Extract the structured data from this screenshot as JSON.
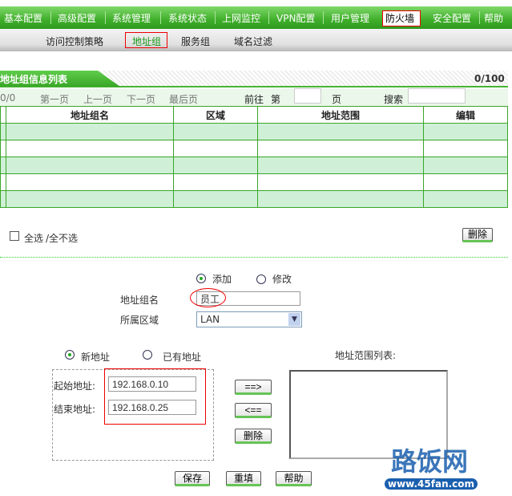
{
  "nav": {
    "items": [
      "基本配置",
      "高级配置",
      "系统管理",
      "系统状态",
      "上网监控",
      "VPN配置",
      "用户管理",
      "防火墙",
      "安全配置",
      "帮助"
    ],
    "active": "防火墙"
  },
  "subnav": {
    "items": [
      "访问控制策略",
      "地址组",
      "服务组",
      "域名过滤"
    ],
    "active": "地址组"
  },
  "list": {
    "title": "地址组信息列表",
    "count": "0/100",
    "pager": {
      "pages": "0/0",
      "first": "第一页",
      "prev": "上一页",
      "next": "下一页",
      "last": "最后页",
      "goto": "前往",
      "di": "第",
      "ye": "页",
      "search": "搜索",
      "page_value": "",
      "search_value": ""
    },
    "columns": [
      "",
      "地址组名",
      "区域",
      "地址范围",
      "编辑"
    ],
    "rows": 5,
    "select_all": "全选",
    "select_none": "/全不选",
    "delete": "删除"
  },
  "form": {
    "mode_add": "添加",
    "mode_edit": "修改",
    "name_label": "地址组名",
    "name_value": "员工",
    "zone_label": "所属区域",
    "zone_value": "LAN",
    "new_addr": "新地址",
    "existing_addr": "已有地址",
    "range_list_label": "地址范围列表:",
    "start_label": "起始地址:",
    "start_value": "192.168.0.10",
    "end_label": "结束地址:",
    "end_value": "192.168.0.25",
    "add_btn": "==>",
    "remove_btn": "<==",
    "delete_btn": "删除",
    "save": "保存",
    "reset": "重填",
    "help": "帮助"
  },
  "watermark": {
    "brand": "路饭网",
    "url": "www.45fan.com"
  }
}
